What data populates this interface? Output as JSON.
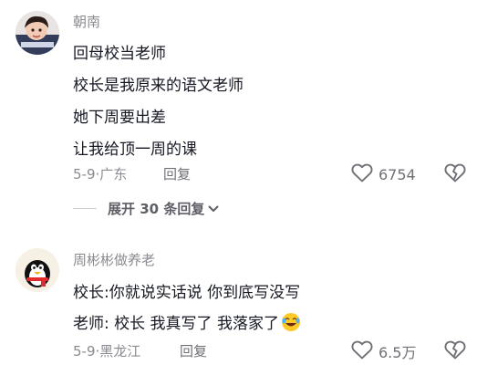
{
  "comments": [
    {
      "username": "朝南",
      "lines": [
        "回母校当老师",
        "校长是我原来的语文老师",
        "她下周要出差",
        "让我给顶一周的课"
      ],
      "date": "5-9",
      "location": "广东",
      "reply_label": "回复",
      "likes": "6754",
      "expand_label": "展开 30 条回复"
    },
    {
      "username": "周彬彬做养老",
      "lines": [
        "校长:你就说实话说 你到底写没写",
        "老师: 校长 我真写了 我落家了"
      ],
      "date": "5-9",
      "location": "黑龙江",
      "reply_label": "回复",
      "likes": "6.5万"
    }
  ],
  "icons": {
    "like": "heart-outline-icon",
    "dislike": "broken-heart-icon",
    "expand": "chevron-down-icon",
    "emoji": "laughing-crying-emoji-icon"
  },
  "colors": {
    "text_primary": "#161823",
    "text_secondary": "#8a8b91",
    "icon": "#6f7076"
  }
}
